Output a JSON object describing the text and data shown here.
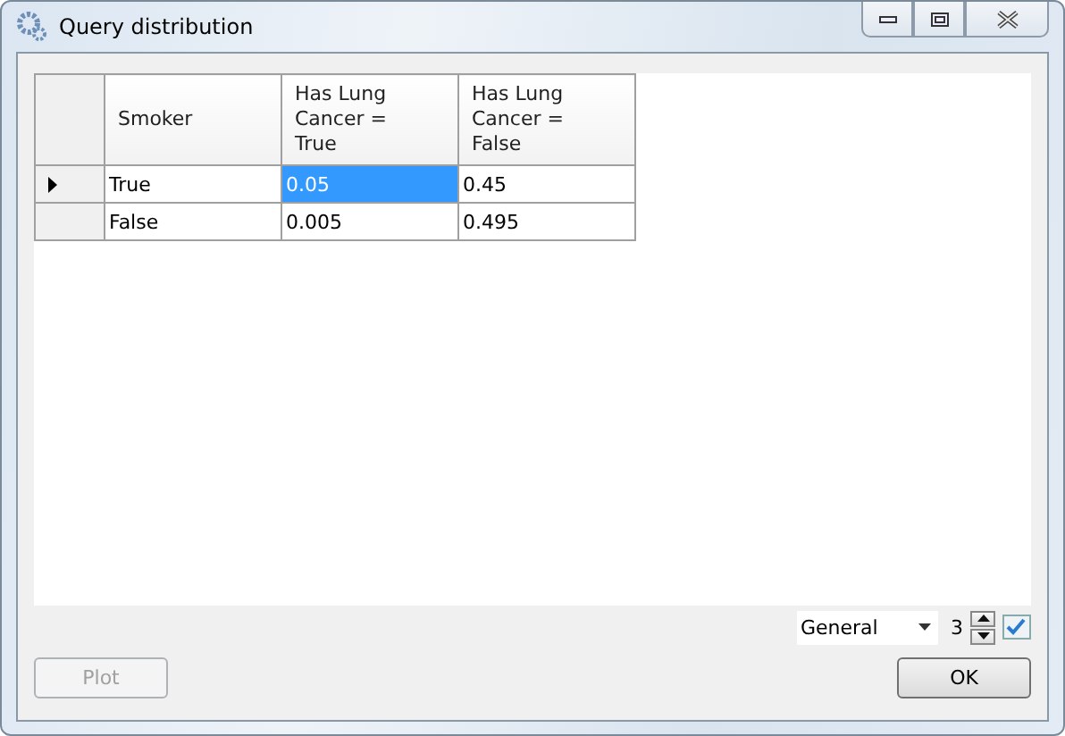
{
  "window": {
    "title": "Query distribution"
  },
  "table": {
    "columns": [
      "Smoker",
      "Has Lung Cancer = True",
      "Has Lung Cancer = False"
    ],
    "rows": [
      {
        "current": true,
        "cells": [
          {
            "text": "True",
            "selected": false
          },
          {
            "text": "0.05",
            "selected": true
          },
          {
            "text": "0.45",
            "selected": false
          }
        ]
      },
      {
        "current": false,
        "cells": [
          {
            "text": "False",
            "selected": false
          },
          {
            "text": "0.005",
            "selected": false
          },
          {
            "text": "0.495",
            "selected": false
          }
        ]
      }
    ]
  },
  "format": {
    "value": "General"
  },
  "decimals": {
    "value": "3"
  },
  "buttons": [
    {
      "label": "Plot",
      "disabled": true
    },
    {
      "label": "OK",
      "disabled": false
    }
  ]
}
